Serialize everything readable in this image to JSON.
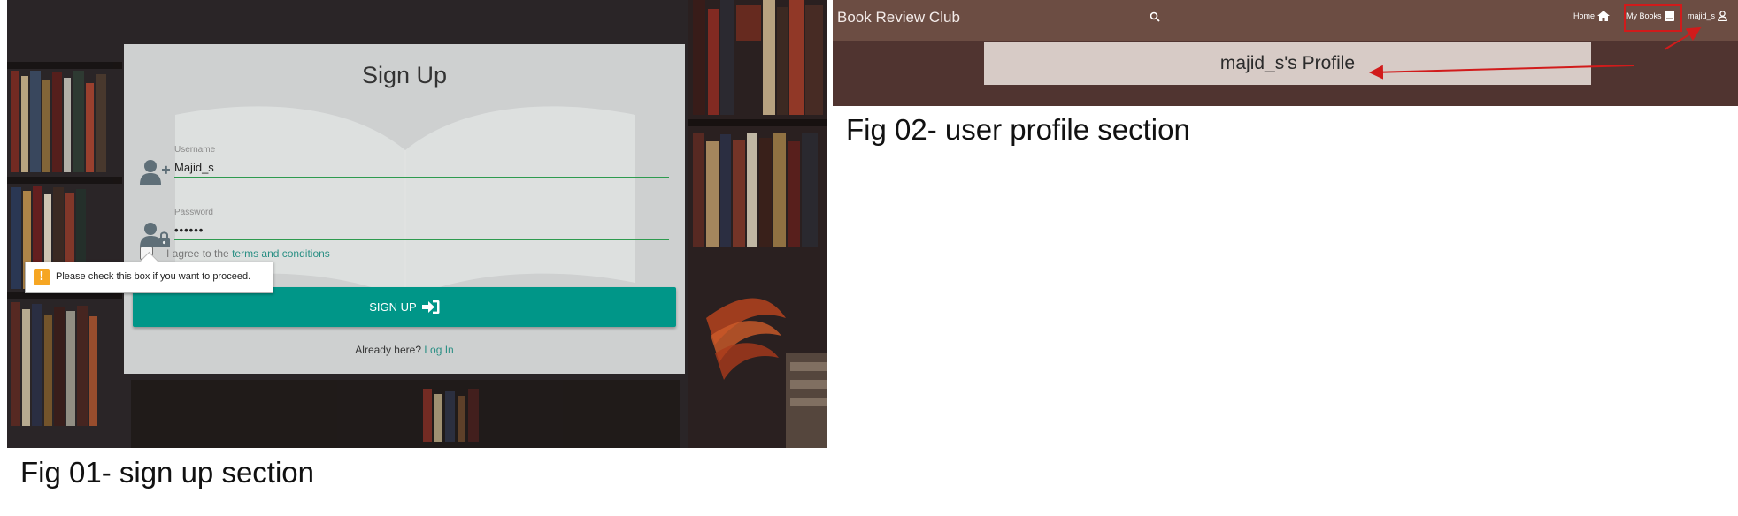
{
  "fig1": {
    "title": "Sign Up",
    "username": {
      "label": "Username",
      "value": "Majid_s",
      "icon": "user-plus-icon"
    },
    "password": {
      "label": "Password",
      "value": "••••••",
      "icon": "user-lock-icon"
    },
    "agree": {
      "prefix": "I agree to the ",
      "link": "terms and conditions"
    },
    "tooltip": {
      "text": "Please check this box if you want to proceed.",
      "icon": "warning-icon"
    },
    "signup_button": {
      "label": "SIGN UP",
      "icon": "sign-in-icon"
    },
    "already": {
      "text": "Already here?",
      "link": "Log In"
    },
    "caption": "Fig 01- sign up section",
    "colors": {
      "accent": "#009688",
      "underline": "#2e9b4f",
      "link": "#2a8f84"
    }
  },
  "fig2": {
    "brand": "Book Review Club",
    "nav": {
      "search_icon": "search-icon",
      "home": {
        "label": "Home",
        "icon": "home-icon"
      },
      "my_books": {
        "label": "My Books",
        "icon": "book-icon"
      },
      "user": {
        "label": "majid_s",
        "icon": "user-icon"
      }
    },
    "profile_title": "majid_s's Profile",
    "caption": "Fig 02- user profile section",
    "colors": {
      "navbar": "#6c4d43",
      "background": "#503430",
      "banner": "#d7cbc6",
      "annotation": "#d11b1b"
    }
  }
}
